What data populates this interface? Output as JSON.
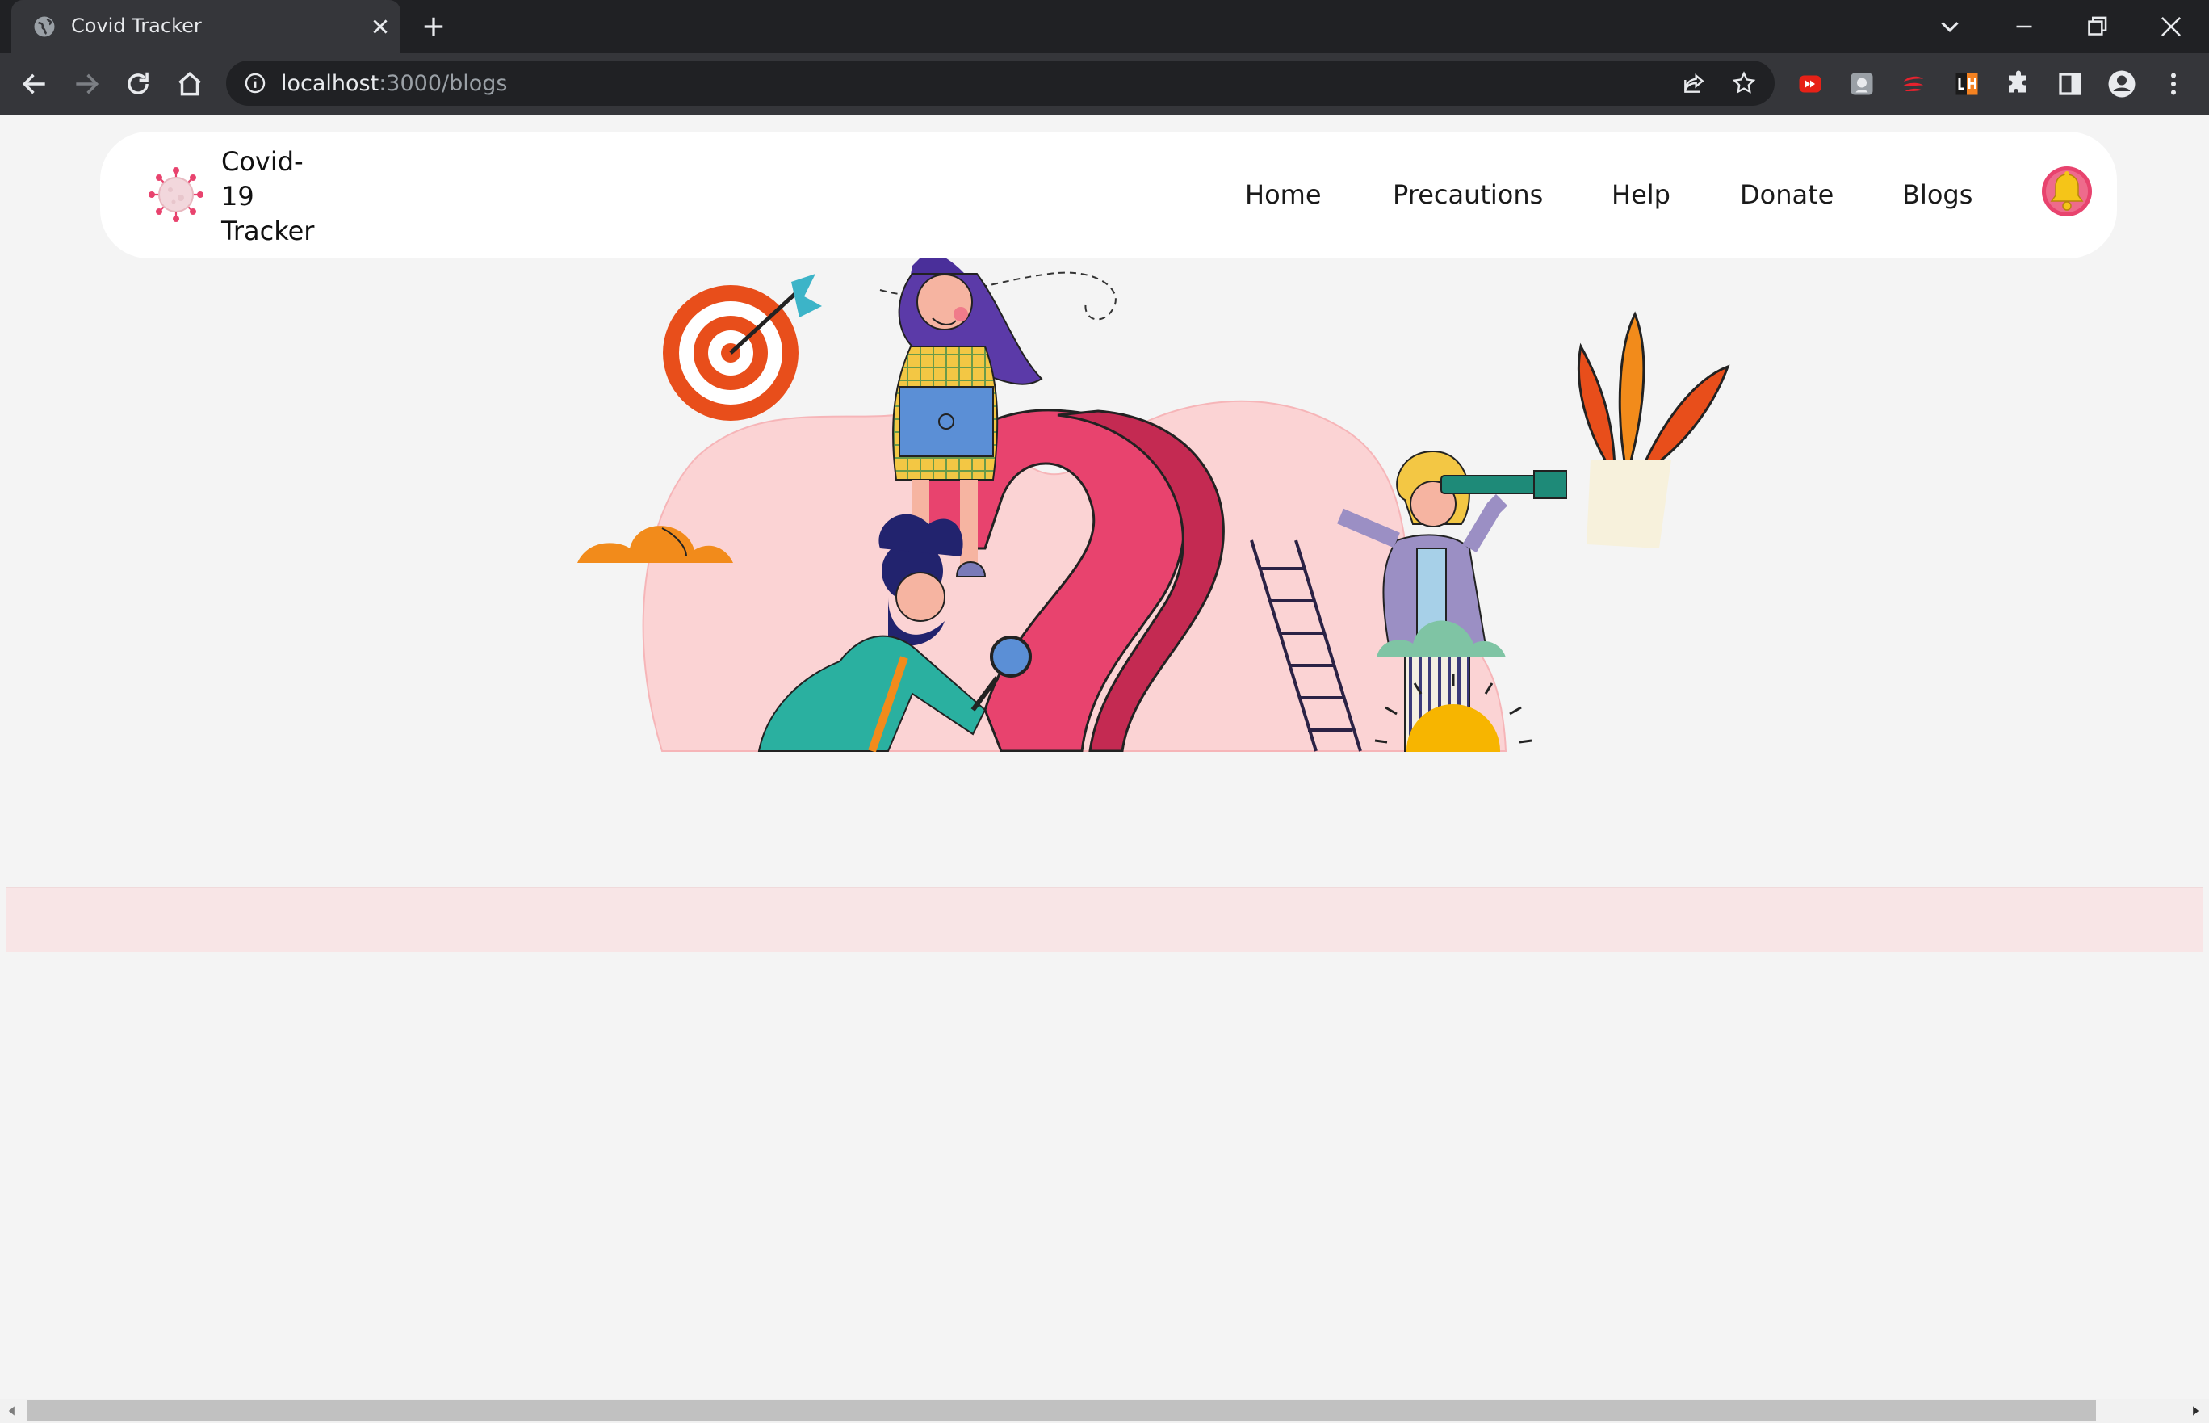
{
  "browser": {
    "tab_title": "Covid Tracker",
    "url_host": "localhost",
    "url_path": ":3000/blogs"
  },
  "navbar": {
    "brand": "Covid-19 Tracker",
    "links": [
      "Home",
      "Precautions",
      "Help",
      "Donate",
      "Blogs"
    ]
  },
  "colors": {
    "accent_pink": "#e8436e",
    "bell_yellow": "#f5c518",
    "hero_blob": "#fbd3d4",
    "strip": "#f8e5e6"
  },
  "icons": {
    "logo": "virus-icon",
    "notification": "bell-icon"
  }
}
